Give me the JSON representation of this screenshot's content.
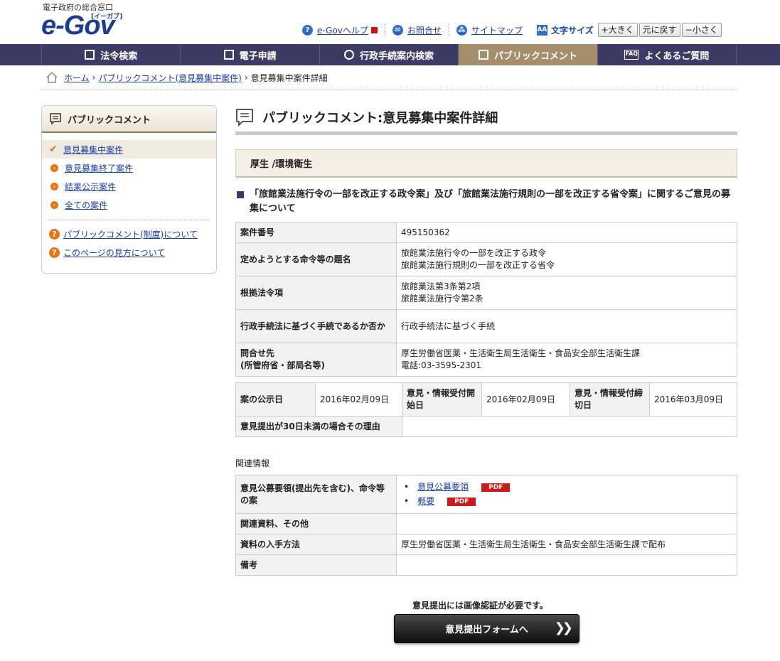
{
  "header": {
    "tagline": "電子政府の総合窓口",
    "logo": "e-Gov",
    "logo_sub": "[イーガブ]",
    "links": [
      {
        "label": "e-Govヘルプ",
        "icon": "help-icon"
      },
      {
        "label": "お問合せ",
        "icon": "mail-icon"
      },
      {
        "label": "サイトマップ",
        "icon": "sitemap-icon"
      }
    ],
    "font_size": {
      "label": "文字サイズ",
      "larger": "+大きく",
      "reset": "元に戻す",
      "smaller": "−小さく"
    }
  },
  "nav": [
    {
      "label": "法令検索",
      "icon": "book-icon"
    },
    {
      "label": "電子申請",
      "icon": "edit-icon"
    },
    {
      "label": "行政手続案内検索",
      "icon": "search-icon"
    },
    {
      "label": "パブリックコメント",
      "icon": "comment-icon"
    },
    {
      "label": "よくあるご質問",
      "icon": "faq-icon"
    }
  ],
  "breadcrumb": {
    "home": "ホーム",
    "level1": "パブリックコメント(意見募集中案件)",
    "current": "意見募集中案件詳細"
  },
  "sidebar": {
    "title": "パブリックコメント",
    "items": [
      {
        "label": "意見募集中案件"
      },
      {
        "label": "意見募集終了案件"
      },
      {
        "label": "結果公示案件"
      },
      {
        "label": "全ての案件"
      }
    ],
    "help": [
      {
        "label": "パブリックコメント(制度)について"
      },
      {
        "label": "このページの見方について"
      }
    ]
  },
  "main": {
    "title": "パブリックコメント:意見募集中案件詳細",
    "category": "厚生 /環境衛生",
    "case_title": "「旅館業法施行令の一部を改正する政令案」及び「旅館業法施行規則の一部を改正する省令案」に関するご意見の募集について",
    "details": {
      "case_number_label": "案件番号",
      "case_number": "495150362",
      "subject_label": "定めようとする命令等の題名",
      "subject_line1": "旅館業法施行令の一部を改正する政令",
      "subject_line2": "旅館業法施行規則の一部を改正する省令",
      "basis_label": "根拠法令項",
      "basis_line1": "旅館業法第3条第2項",
      "basis_line2": "旅館業法施行令第2条",
      "procedure_label": "行政手続法に基づく手続であるか否か",
      "procedure": "行政手続法に基づく手続",
      "contact_label_line1": "問合せ先",
      "contact_label_line2": "(所管府省・部局名等)",
      "contact_line1": "厚生労働省医薬・生活衛生局生活衛生・食品安全部生活衛生課",
      "contact_line2": "電話:03-3595-2301"
    },
    "dates": {
      "publish_label": "案の公示日",
      "publish": "2016年02月09日",
      "start_label": "意見・情報受付開始日",
      "start": "2016年02月09日",
      "end_label": "意見・情報受付締切日",
      "end": "2016年03月09日",
      "reason_label": "意見提出が30日未満の場合その理由",
      "reason": ""
    },
    "related_heading": "関連情報",
    "related": {
      "docs_label": "意見公募要領(提出先を含む)、命令等の案",
      "doc_links": [
        {
          "label": "意見公募要領",
          "badge": "PDF"
        },
        {
          "label": "概要",
          "badge": "PDF"
        }
      ],
      "materials_label": "関連資料、その他",
      "materials": "",
      "method_label": "資料の入手方法",
      "method": "厚生労働省医薬・生活衛生局生活衛生・食品安全部生活衛生課で配布",
      "remarks_label": "備考",
      "remarks": ""
    },
    "submit_note": "意見提出には画像認証が必要です。",
    "submit_button": "意見提出フォームへ"
  }
}
